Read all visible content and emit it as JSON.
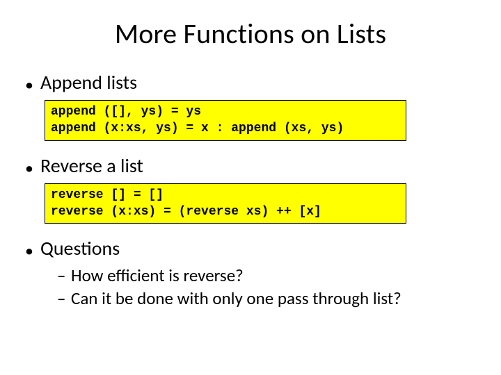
{
  "title": "More Functions on Lists",
  "items": [
    {
      "label": "Append lists",
      "code": "append ([], ys) = ys\nappend (x:xs, ys) = x : append (xs, ys)"
    },
    {
      "label": "Reverse a list",
      "code": "reverse [] = []\nreverse (x:xs) = (reverse xs) ++ [x]"
    },
    {
      "label": "Questions",
      "subitems": [
        "How efficient is reverse?",
        "Can it be done with only one pass through list?"
      ]
    }
  ]
}
